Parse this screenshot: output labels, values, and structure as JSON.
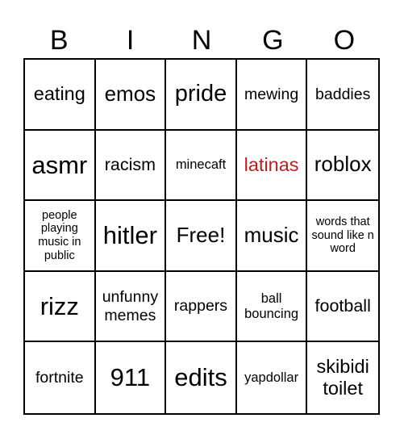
{
  "header": [
    "B",
    "I",
    "N",
    "G",
    "O"
  ],
  "colors": {
    "highlight": "#b22222",
    "text": "#000000",
    "border": "#000000",
    "background": "#ffffff"
  },
  "cells": [
    {
      "text": "eating",
      "size": "s23"
    },
    {
      "text": "emos",
      "size": "s26"
    },
    {
      "text": "pride",
      "size": "s28"
    },
    {
      "text": "mewing",
      "size": "s19"
    },
    {
      "text": "baddies",
      "size": "s19"
    },
    {
      "text": "asmr",
      "size": "s30"
    },
    {
      "text": "racism",
      "size": "s21"
    },
    {
      "text": "minecaft",
      "size": "s16"
    },
    {
      "text": "latinas",
      "size": "s23",
      "color": "#b22222"
    },
    {
      "text": "roblox",
      "size": "s26"
    },
    {
      "text": "people playing music in public",
      "size": "s14"
    },
    {
      "text": "hitler",
      "size": "s30"
    },
    {
      "text": "Free!",
      "size": "s26",
      "free": true
    },
    {
      "text": "music",
      "size": "s26"
    },
    {
      "text": "words that sound like n word",
      "size": "s14"
    },
    {
      "text": "rizz",
      "size": "s30"
    },
    {
      "text": "unfunny memes",
      "size": "s19"
    },
    {
      "text": "rappers",
      "size": "s19"
    },
    {
      "text": "ball bouncing",
      "size": "s16"
    },
    {
      "text": "football",
      "size": "s21"
    },
    {
      "text": "fortnite",
      "size": "s19"
    },
    {
      "text": "911",
      "size": "s30"
    },
    {
      "text": "edits",
      "size": "s30"
    },
    {
      "text": "yapdollar",
      "size": "s16"
    },
    {
      "text": "skibidi toilet",
      "size": "s23"
    }
  ]
}
